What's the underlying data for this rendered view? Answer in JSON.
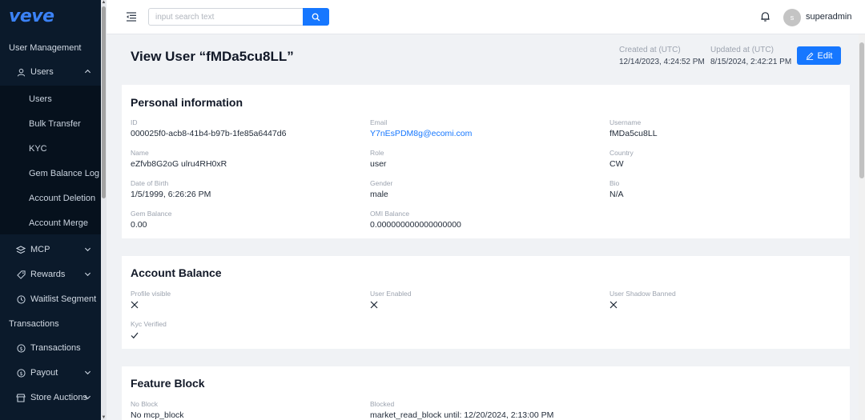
{
  "sidebar": {
    "logo": "veve",
    "sections": {
      "user_management": "User Management",
      "transactions": "Transactions"
    },
    "users_group": {
      "label": "Users",
      "icon": "user-icon"
    },
    "users_subitems": [
      "Users",
      "Bulk Transfer",
      "KYC",
      "Gem Balance Log",
      "Account Deletion",
      "Account Merge"
    ],
    "items": {
      "mcp": "MCP",
      "rewards": "Rewards",
      "waitlist": "Waitlist Segment",
      "transactions": "Transactions",
      "payout": "Payout",
      "store_auctions": "Store Auctions"
    }
  },
  "topbar": {
    "search_placeholder": "input search text",
    "user_initial": "s",
    "username": "superadmin"
  },
  "header": {
    "title": "View User “fMDa5cu8LL”",
    "created_label": "Created at (UTC)",
    "created_value": "12/14/2023, 4:24:52 PM",
    "updated_label": "Updated at (UTC)",
    "updated_value": "8/15/2024, 2:42:21 PM",
    "edit_label": "Edit"
  },
  "personal": {
    "title": "Personal information",
    "id_label": "ID",
    "id_value": "000025f0-acb8-41b4-b97b-1fe85a6447d6",
    "email_label": "Email",
    "email_value": "Y7nEsPDM8g@ecomi.com",
    "username_label": "Username",
    "username_value": "fMDa5cu8LL",
    "name_label": "Name",
    "name_value": "eZfvb8G2oG ulru4RH0xR",
    "role_label": "Role",
    "role_value": "user",
    "country_label": "Country",
    "country_value": "CW",
    "dob_label": "Date of Birth",
    "dob_value": "1/5/1999, 6:26:26 PM",
    "gender_label": "Gender",
    "gender_value": "male",
    "bio_label": "Bio",
    "bio_value": "N/A",
    "gem_label": "Gem Balance",
    "gem_value": "0.00",
    "omi_label": "OMI Balance",
    "omi_value": "0.000000000000000000"
  },
  "account": {
    "title": "Account Balance",
    "profile_visible_label": "Profile visible",
    "profile_visible": false,
    "user_enabled_label": "User Enabled",
    "user_enabled": false,
    "shadow_banned_label": "User Shadow Banned",
    "shadow_banned": false,
    "kyc_label": "Kyc Verified",
    "kyc_verified": true
  },
  "feature_block": {
    "title": "Feature Block",
    "no_block_label": "No Block",
    "no_block_value": "No mcp_block",
    "blocked_label": "Blocked",
    "blocked_value": "market_read_block until: 12/20/2024, 2:13:00 PM"
  },
  "colors": {
    "accent": "#1677ff",
    "sidebar_bg": "#0b1a2b",
    "logo": "#3b82f6"
  }
}
